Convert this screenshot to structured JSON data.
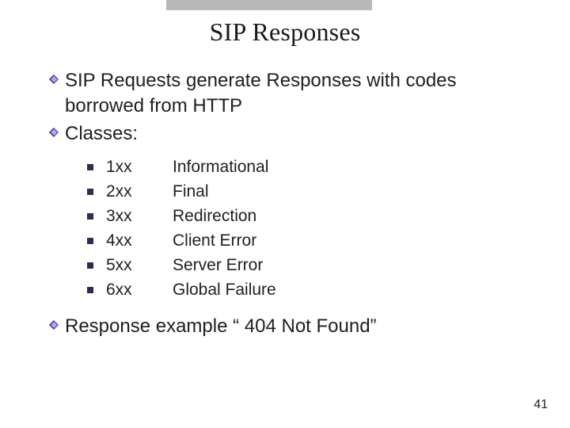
{
  "title": "SIP Responses",
  "bullets": {
    "b1": "SIP Requests generate Responses with codes borrowed from HTTP",
    "b2": "Classes:",
    "b3": "Response example “ 404 Not Found”"
  },
  "classes": [
    {
      "code": "1xx",
      "desc": "Informational"
    },
    {
      "code": "2xx",
      "desc": "Final"
    },
    {
      "code": "3xx",
      "desc": "Redirection"
    },
    {
      "code": "4xx",
      "desc": "Client Error"
    },
    {
      "code": "5xx",
      "desc": "Server Error"
    },
    {
      "code": "6xx",
      "desc": "Global Failure"
    }
  ],
  "page_number": "41",
  "colors": {
    "accent": "#3a2a7a",
    "sub": "#2b2e52"
  }
}
